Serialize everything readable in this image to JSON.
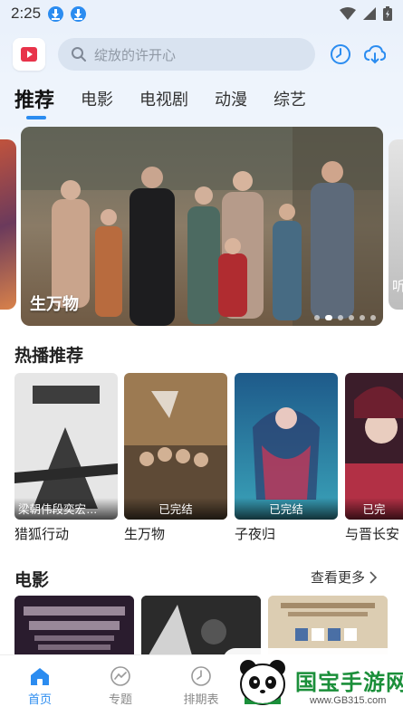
{
  "status_bar": {
    "time": "2:25"
  },
  "search": {
    "placeholder": "绽放的许开心"
  },
  "tabs": [
    {
      "label": "推荐",
      "active": true
    },
    {
      "label": "电影",
      "active": false
    },
    {
      "label": "电视剧",
      "active": false
    },
    {
      "label": "动漫",
      "active": false
    },
    {
      "label": "综艺",
      "active": false
    }
  ],
  "banner": {
    "title": "生万物",
    "peek_right": "听",
    "slide_count": 6,
    "active_slide": 2
  },
  "hot_section": {
    "title": "热播推荐",
    "items": [
      {
        "title": "猎狐行动",
        "tag": "梁朝伟段奕宏…"
      },
      {
        "title": "生万物",
        "tag": "已完结"
      },
      {
        "title": "子夜归",
        "tag": "已完结"
      },
      {
        "title": "与晋长安",
        "tag": "已完"
      }
    ]
  },
  "movie_section": {
    "title": "电影",
    "more": "查看更多"
  },
  "bottom_nav": [
    {
      "label": "首页",
      "active": true,
      "icon": "home-icon"
    },
    {
      "label": "专题",
      "active": false,
      "icon": "trend-icon"
    },
    {
      "label": "排期表",
      "active": false,
      "icon": "clock-icon"
    }
  ],
  "watermark": {
    "title": "国宝手游网",
    "url": "www.GB315.com"
  },
  "colors": {
    "accent": "#2b8cf0",
    "header_bg": "#eaf1fb",
    "watermark_green": "#1b8f3a"
  }
}
